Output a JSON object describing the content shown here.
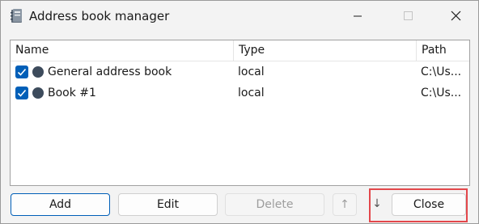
{
  "window": {
    "title": "Address book manager",
    "app_icon": "address-book-icon"
  },
  "titlebar_buttons": {
    "minimize_icon": "minimize-icon",
    "maximize_icon": "maximize-icon",
    "close_icon": "close-icon"
  },
  "table": {
    "columns": [
      "Name",
      "Type",
      "Path"
    ],
    "rows": [
      {
        "checked": true,
        "name": "General address book",
        "type": "local",
        "path": "C:\\Us..."
      },
      {
        "checked": true,
        "name": "Book #1",
        "type": "local",
        "path": "C:\\Us..."
      }
    ]
  },
  "buttons": {
    "add": "Add",
    "edit": "Edit",
    "delete": "Delete",
    "up": "↑",
    "down": "↓",
    "close": "Close"
  },
  "colors": {
    "accent": "#005fb8",
    "highlight": "#e3474b",
    "status_dot": "#3d4b5c"
  }
}
